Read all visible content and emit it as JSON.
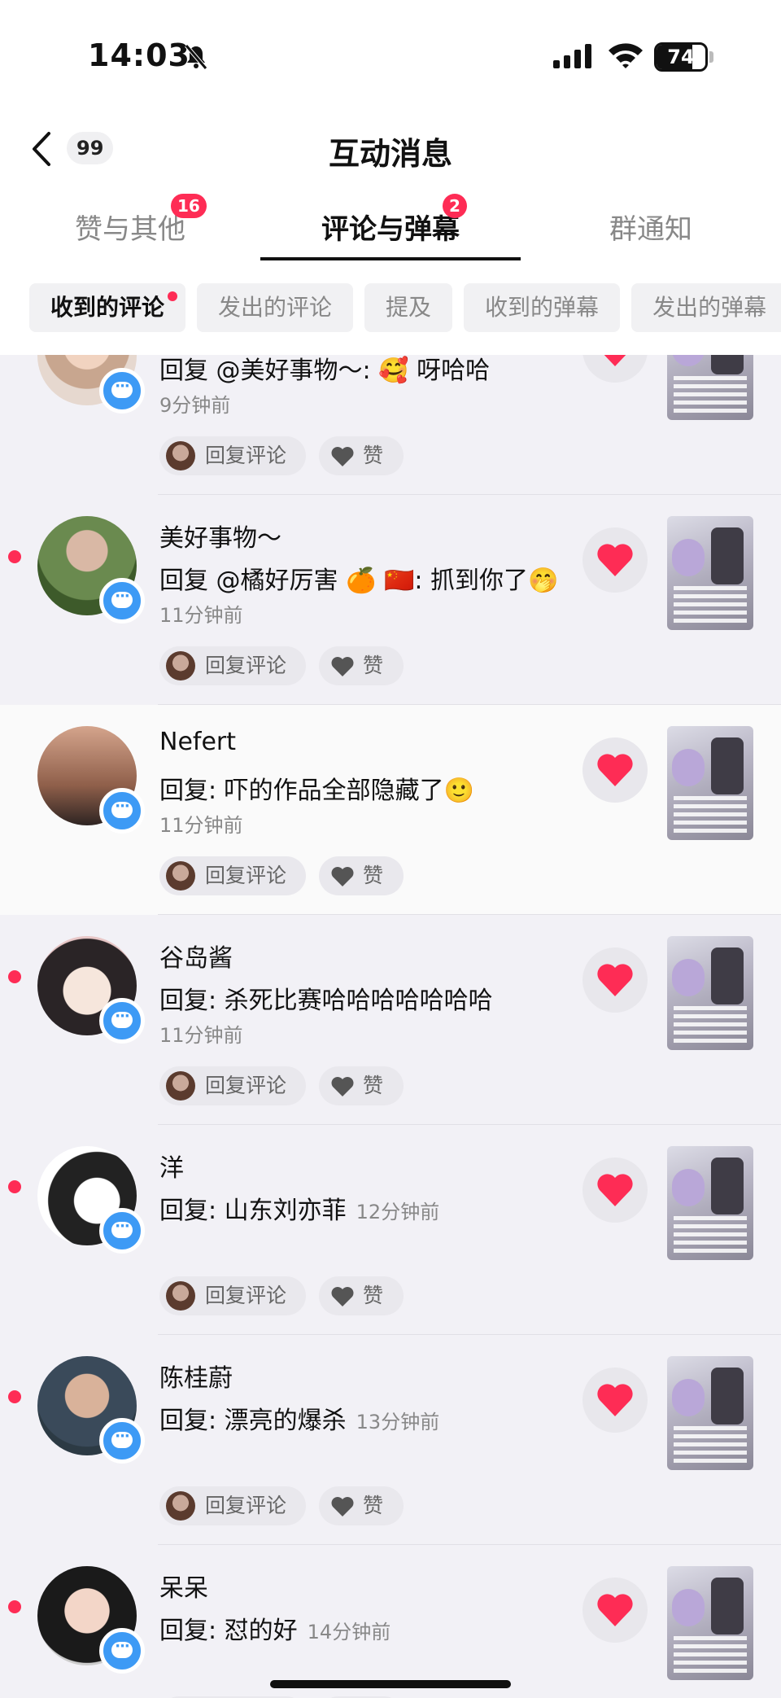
{
  "status_bar": {
    "time": "14:03",
    "battery": "74",
    "battery_level": 0.74
  },
  "nav": {
    "unread_count": "99",
    "title": "互动消息"
  },
  "tabs": [
    {
      "label": "赞与其他",
      "badge": "16"
    },
    {
      "label": "评论与弹幕",
      "badge": "2"
    },
    {
      "label": "群通知",
      "badge": ""
    }
  ],
  "chips": [
    "收到的评论",
    "发出的评论",
    "提及",
    "收到的弹幕",
    "发出的弹幕"
  ],
  "actions": {
    "reply_label": "回复评论",
    "like_label": "赞"
  },
  "items": [
    {
      "name": "",
      "comment": "回复 @美好事物～: 🥰 呀哈哈",
      "time": "9分钟前",
      "unread": true
    },
    {
      "name": "美好事物～",
      "comment": "回复 @橘好厉害 🍊 🇨🇳: 抓到你了🤭",
      "time": "11分钟前",
      "unread": true
    },
    {
      "name": "Nefert",
      "comment": "回复: 吓的作品全部隐藏了🙂",
      "time": "11分钟前",
      "unread": false
    },
    {
      "name": "谷岛酱",
      "comment": "回复: 杀死比赛哈哈哈哈哈哈哈",
      "time": "11分钟前",
      "unread": true
    },
    {
      "name": "洋",
      "comment": "回复: 山东刘亦菲",
      "time": "12分钟前",
      "unread": true
    },
    {
      "name": "陈桂蔚",
      "comment": "回复: 漂亮的爆杀",
      "time": "13分钟前",
      "unread": true
    },
    {
      "name": "呆呆",
      "comment": "回复: 怼的好",
      "time": "14分钟前",
      "unread": true
    }
  ],
  "colors": {
    "accent": "#fe2c55",
    "badge_blue": "#3d9af5",
    "background": "#f2f1f6"
  }
}
